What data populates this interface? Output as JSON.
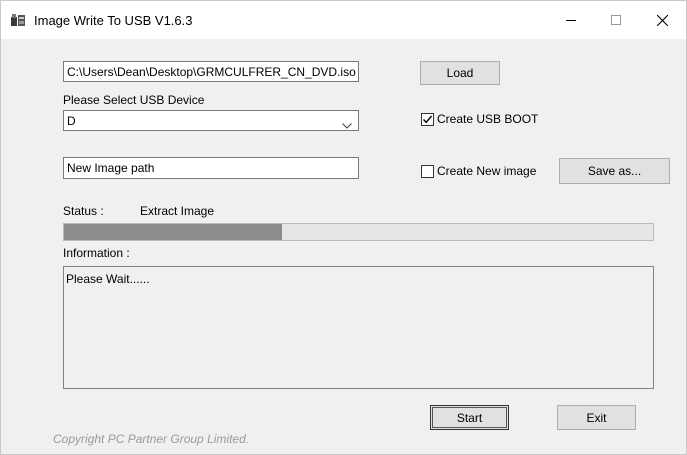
{
  "window": {
    "title": "Image Write To USB  V1.6.3"
  },
  "iso_path": {
    "value": "C:\\Users\\Dean\\Desktop\\GRMCULFRER_CN_DVD.iso"
  },
  "load_button": {
    "label": "Load"
  },
  "usb_device": {
    "label": "Please Select USB Device",
    "selected": "D"
  },
  "create_usb_boot": {
    "label": "Create USB BOOT",
    "checked": true
  },
  "image_path": {
    "value": "New Image path"
  },
  "create_new_image": {
    "label": "Create New image",
    "checked": false
  },
  "save_as_button": {
    "label": "Save as..."
  },
  "status": {
    "label": "Status :",
    "value": "Extract Image"
  },
  "progress": {
    "fraction": 0.37
  },
  "information": {
    "label": "Information :",
    "text": "Please Wait......"
  },
  "start_button": {
    "label": "Start"
  },
  "exit_button": {
    "label": "Exit"
  },
  "copyright": "Copyright PC Partner Group Limited.",
  "icons": {
    "app": "usb-app-icon",
    "minimize": "minimize-icon",
    "maximize": "maximize-icon",
    "close": "close-icon",
    "dropdown": "chevron-down-icon",
    "check": "checkmark-icon"
  }
}
